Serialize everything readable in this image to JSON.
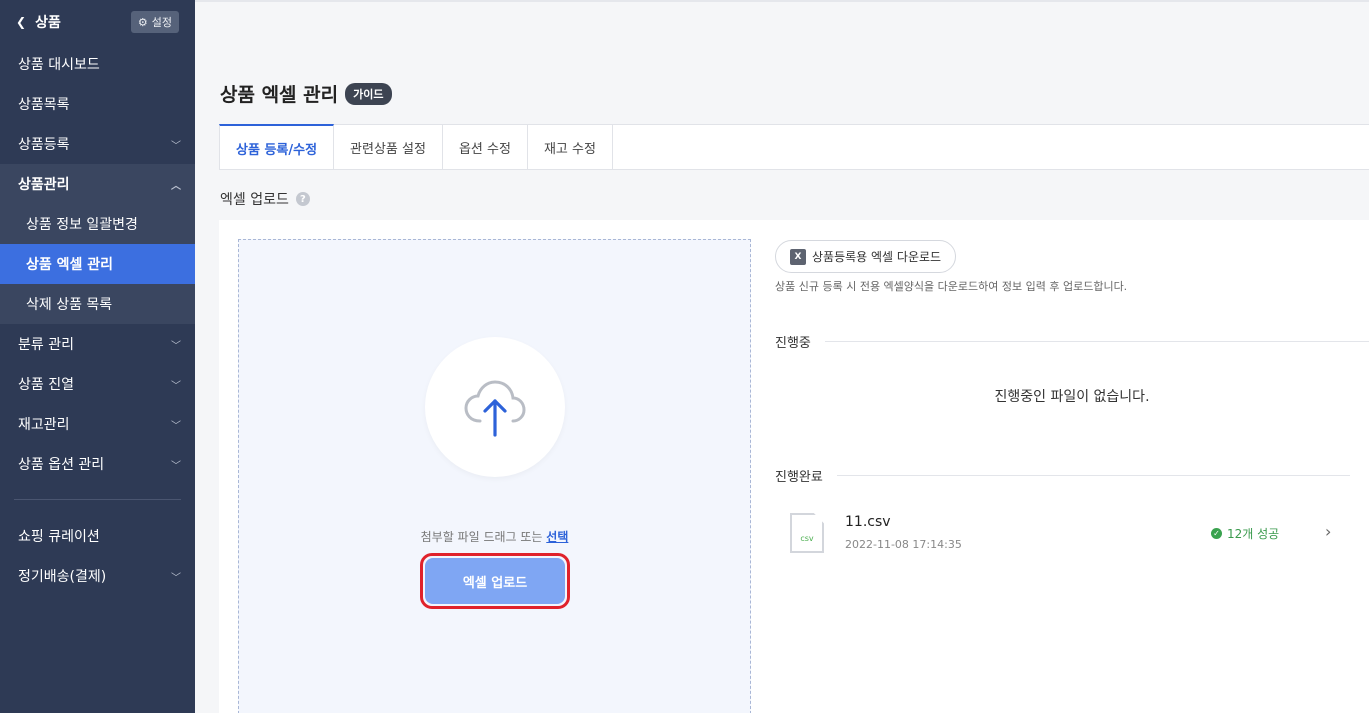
{
  "sidebar": {
    "back_label": "상품",
    "settings_label": "설정",
    "items": [
      {
        "label": "상품 대시보드"
      },
      {
        "label": "상품목록"
      },
      {
        "label": "상품등록"
      },
      {
        "label": "상품관리"
      },
      {
        "label": "상품 정보 일괄변경"
      },
      {
        "label": "상품 엑셀 관리"
      },
      {
        "label": "삭제 상품 목록"
      },
      {
        "label": "분류 관리"
      },
      {
        "label": "상품 진열"
      },
      {
        "label": "재고관리"
      },
      {
        "label": "상품 옵션 관리"
      },
      {
        "label": "쇼핑 큐레이션"
      },
      {
        "label": "정기배송(결제)"
      }
    ]
  },
  "page": {
    "title": "상품 엑셀 관리",
    "guide_badge": "가이드"
  },
  "tabs": [
    {
      "label": "상품 등록/수정"
    },
    {
      "label": "관련상품 설정"
    },
    {
      "label": "옵션 수정"
    },
    {
      "label": "재고 수정"
    }
  ],
  "upload": {
    "section_title": "엑셀 업로드",
    "help_icon": "?",
    "drop_text": "첨부할 파일 드래그 또는 ",
    "select_link": "선택",
    "upload_button": "엑셀 업로드"
  },
  "right": {
    "download_button": "상품등록용 엑셀 다운로드",
    "download_icon_text": "X",
    "download_desc": "상품 신규 등록 시 전용 엑셀양식을 다운로드하여 정보 입력 후 업로드합니다.",
    "in_progress_title": "진행중",
    "empty_message": "진행중인 파일이 없습니다.",
    "completed_title": "진행완료",
    "files": [
      {
        "icon_text": "csv",
        "name": "11.csv",
        "date": "2022-11-08 17:14:35",
        "status": "12개 성공"
      }
    ]
  },
  "colors": {
    "sidebar_bg": "#2e3a55",
    "active_blue": "#3c6fe0",
    "accent": "#2d62d9",
    "upload_button": "#7fa6f3",
    "highlight_border": "#e0222c",
    "success": "#3a9a4d"
  }
}
